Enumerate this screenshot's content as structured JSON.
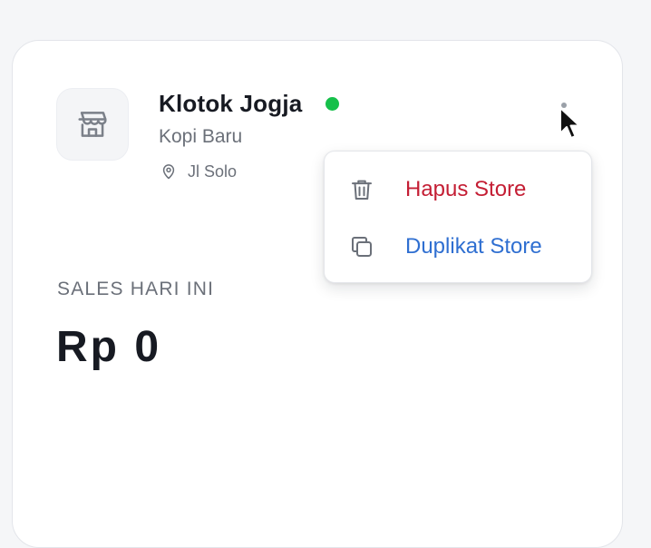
{
  "store": {
    "name": "Klotok Jogja",
    "type": "Kopi Baru",
    "location": "Jl Solo",
    "status_color": "#16c04a",
    "icon": "storefront-icon"
  },
  "sales": {
    "label": "SALES HARI INI",
    "value": "Rp 0"
  },
  "menu": {
    "items": [
      {
        "label": "Hapus Store",
        "icon": "trash-icon",
        "color": "#c41e34"
      },
      {
        "label": "Duplikat Store",
        "icon": "copy-icon",
        "color": "#2f6fd1"
      }
    ]
  }
}
